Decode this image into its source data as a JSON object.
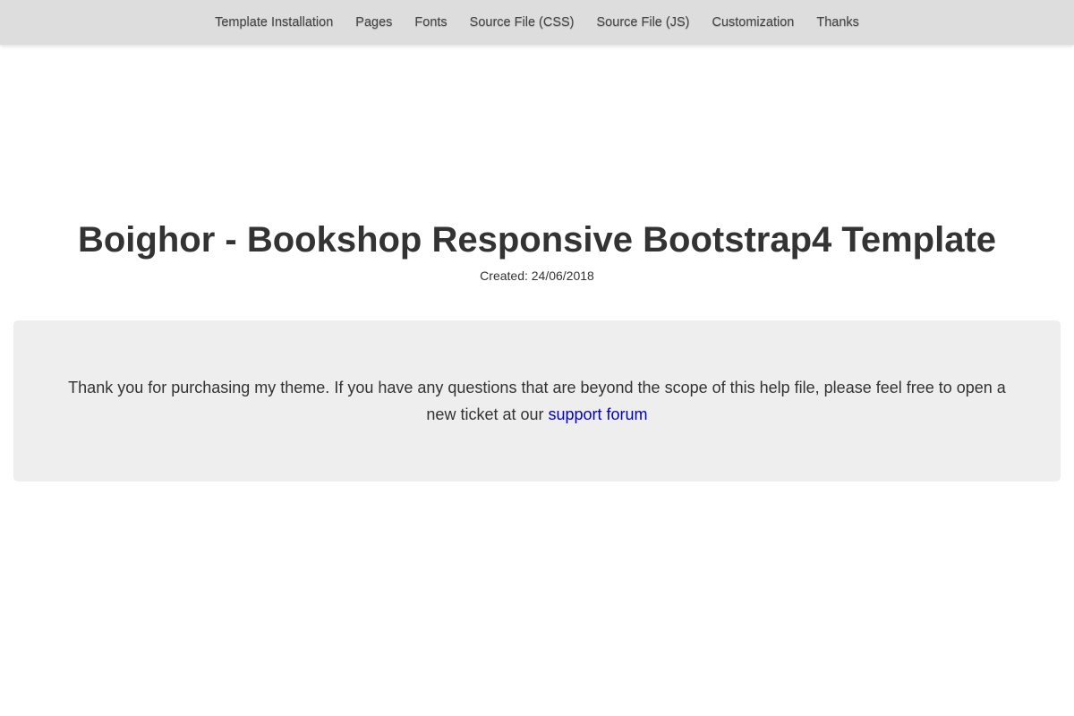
{
  "nav": {
    "items": [
      {
        "label": "Template Installation"
      },
      {
        "label": "Pages"
      },
      {
        "label": "Fonts"
      },
      {
        "label": "Source File (CSS)"
      },
      {
        "label": "Source File (JS)"
      },
      {
        "label": "Customization"
      },
      {
        "label": "Thanks"
      }
    ]
  },
  "header": {
    "title": "Boighor - Bookshop Responsive Bootstrap4 Template",
    "created": "Created: 24/06/2018"
  },
  "thanks": {
    "text": "Thank you for purchasing my theme. If you have any questions that are beyond the scope of this help file, please feel free to open a new ticket at our ",
    "link_label": "support forum"
  },
  "colors": {
    "nav_background": "#dddddd",
    "box_background": "#eeeeee",
    "link": "#0000cc",
    "text": "#333333"
  }
}
